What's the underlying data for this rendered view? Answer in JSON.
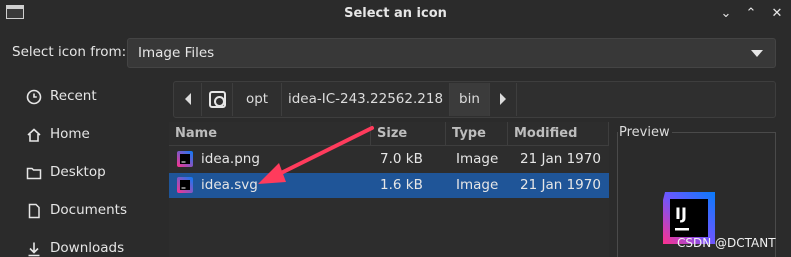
{
  "window": {
    "title": "Select an icon",
    "buttons": {
      "minimize": "⌄",
      "maximize": "⌃",
      "close": "✕"
    }
  },
  "source": {
    "label": "Select icon from:",
    "selected": "Image Files"
  },
  "sidebar": {
    "items": [
      {
        "label": "Recent",
        "icon": "clock-icon"
      },
      {
        "label": "Home",
        "icon": "home-icon"
      },
      {
        "label": "Desktop",
        "icon": "folder-icon"
      },
      {
        "label": "Documents",
        "icon": "document-icon"
      },
      {
        "label": "Downloads",
        "icon": "download-icon"
      }
    ]
  },
  "path": {
    "segments": [
      "opt",
      "idea-IC-243.22562.218",
      "bin"
    ],
    "current": "bin"
  },
  "files": {
    "columns": [
      "Name",
      "Size",
      "Type",
      "Modified"
    ],
    "rows": [
      {
        "name": "idea.png",
        "size": "7.0 kB",
        "type": "Image",
        "modified": "21 Jan 1970",
        "selected": false
      },
      {
        "name": "idea.svg",
        "size": "1.6 kB",
        "type": "Image",
        "modified": "21 Jan 1970",
        "selected": true
      }
    ]
  },
  "preview": {
    "label": "Preview",
    "logo_text": "IJ"
  },
  "watermark": "CSDN @DCTANT",
  "colors": {
    "selection": "#1f5598",
    "annotation_arrow": "#ff3b5c"
  }
}
